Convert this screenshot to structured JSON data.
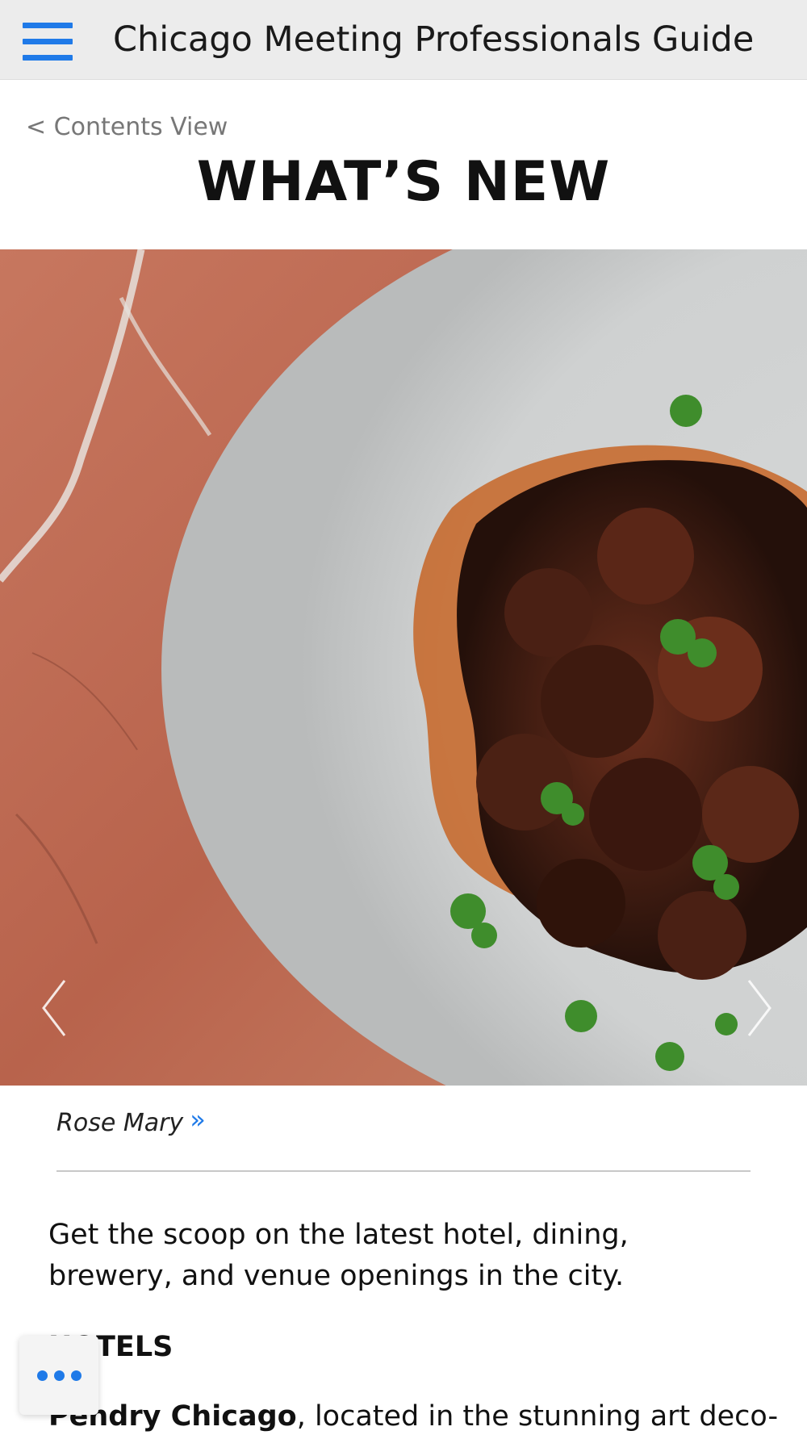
{
  "app": {
    "title": "Chicago Meeting Professionals Guide",
    "menu_icon": "hamburger-menu-icon",
    "accent_color": "#1f7ae8"
  },
  "nav": {
    "back_label": "< Contents View"
  },
  "page": {
    "title": "WHAT’S NEW"
  },
  "hero": {
    "image_description": "Plated grilled meat with herbs and chili oil on a marble table",
    "prev_icon": "chevron-left-icon",
    "next_icon": "chevron-right-icon"
  },
  "caption": {
    "text": "Rose Mary",
    "link_glyph": "»"
  },
  "article": {
    "intro": "Get the scoop on the latest hotel, dining, brewery, and venue openings in the city.",
    "section_heading": "HOTELS",
    "para_bold": "Pendry Chicago",
    "para_rest": ", located in the stunning art deco-"
  },
  "fab": {
    "icon": "more-options-icon"
  }
}
